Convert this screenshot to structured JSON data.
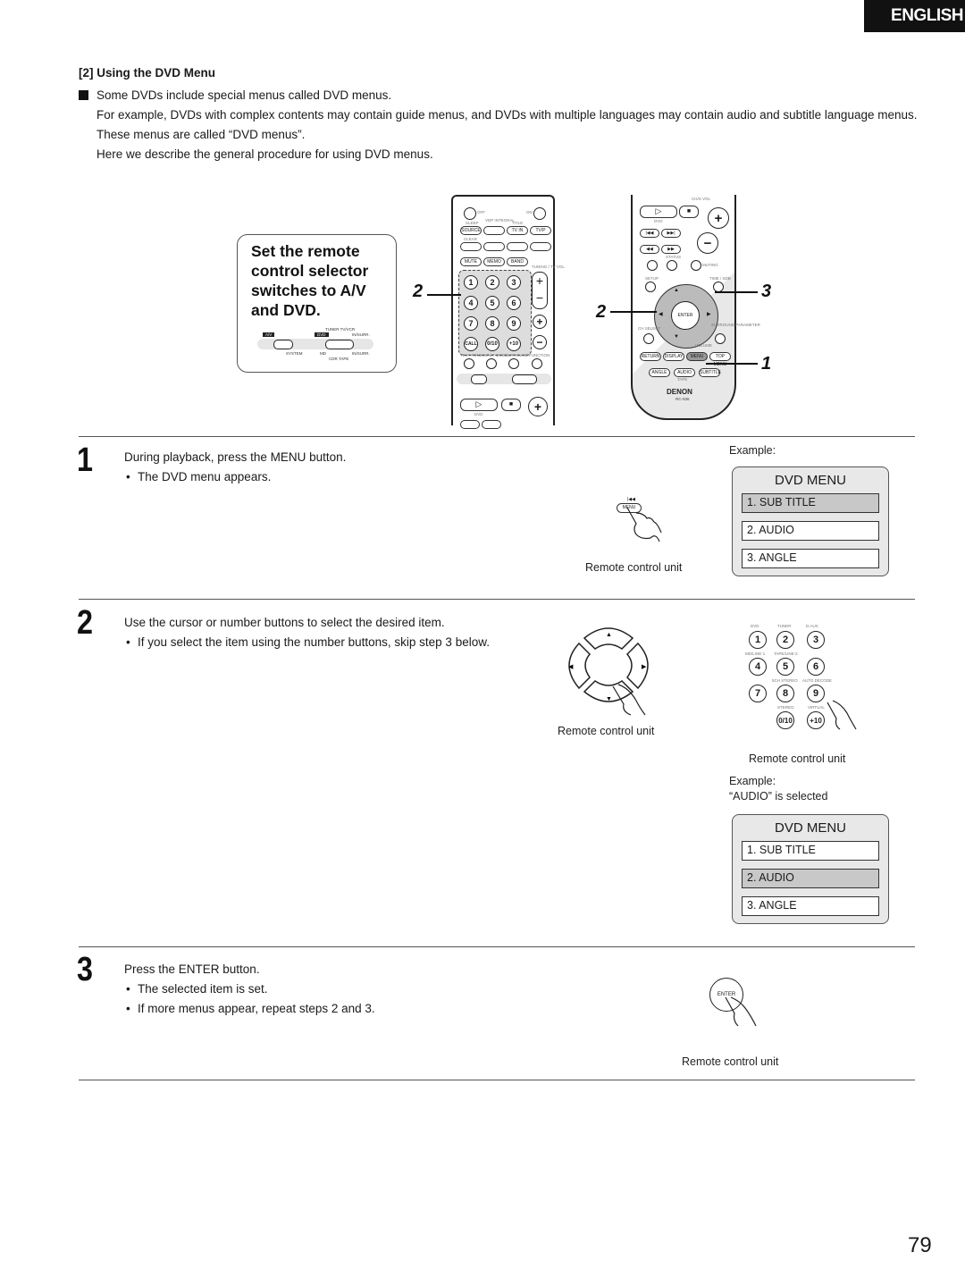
{
  "header": {
    "language_tab": "ENGLISH"
  },
  "section": {
    "title": "[2] Using the DVD Menu",
    "intro": [
      "Some DVDs include special menus called DVD menus.",
      "For example, DVDs with complex contents may contain guide menus, and DVDs with multiple languages may contain audio and subtitle language menus.",
      "These menus are called “DVD menus”.",
      "Here we describe the general procedure for using DVD menus."
    ]
  },
  "callout": {
    "text": "Set the remote control selector switches to A/V and DVD.",
    "switch_labels": {
      "av": "A/V",
      "dvd": "DVD",
      "top_row": "TUNER  TV/VCR",
      "top_end": "IN/SURR.",
      "bottom_left": "SYSTEM",
      "bottom_md": "MD",
      "bottom_row": "CDR  TAPE",
      "bottom_end": "IN/SURR."
    }
  },
  "remote_left": {
    "labels": {
      "off": "OFF",
      "on": "ON",
      "sleep": "SLEEP",
      "source": "SOURCE",
      "vdp": "VDP INTEGRAL",
      "tv_in": "TV IN",
      "title": "TITLE",
      "tv_vcr": "TV/VCR",
      "tvp": "TV/P",
      "clear": "CLEAR",
      "mute": "MUTE",
      "memo": "MEMO",
      "band": "BAND",
      "tuning": "TUNING / TV VOL",
      "test_tone": "TEST TONE",
      "input_mode": "INPUT MODE",
      "surround": "SURROUND",
      "function": "FUNCTION",
      "call": "CALL",
      "dvd": "DVD"
    },
    "number_keys": [
      "1",
      "2",
      "3",
      "4",
      "5",
      "6",
      "7",
      "8",
      "9",
      "0/10",
      "+10"
    ]
  },
  "remote_right": {
    "labels": {
      "ch_vol": "CH/S  VOL",
      "dvd": "DVD",
      "status": "STATUS",
      "muting": "MUTING",
      "setup": "SETUP",
      "time_sdb": "TIME / SDB",
      "enter": "ENTER",
      "ch_select": "CH SELECT",
      "surround_param": "SURROUND PARAMETER",
      "vol": "VOLUME",
      "return": "RETURN",
      "display": "DISPLAY",
      "menu": "MENU",
      "top_menu": "TOP MENU",
      "angle": "ANGLE",
      "audio": "AUDIO",
      "subtitle": "SUBTITLE",
      "tape": "TAPE",
      "brand": "DENON",
      "model": "RC-936"
    }
  },
  "callout_numbers": {
    "left_remote": "2",
    "right_remote_cursor": "2",
    "right_remote_enter": "3",
    "right_remote_menu": "1"
  },
  "steps": [
    {
      "number": "1",
      "text": "During playback, press the MENU button.",
      "bullets": [
        "The DVD menu appears."
      ],
      "illustration_button": "MENU",
      "caption": "Remote control unit",
      "example_label": "Example:",
      "menu": {
        "title": "DVD MENU",
        "items": [
          "1. SUB TITLE",
          "2. AUDIO",
          "3. ANGLE"
        ],
        "selected_index": 0
      }
    },
    {
      "number": "2",
      "text": "Use the cursor or number buttons to select the desired item.",
      "bullets": [
        "If you select the item using the number buttons, skip step 3 below."
      ],
      "caption_cursor": "Remote control unit",
      "caption_numpad": "Remote control unit",
      "numpad_keys": [
        {
          "key": "1",
          "label": "DVD"
        },
        {
          "key": "2",
          "label": "TUNER"
        },
        {
          "key": "3",
          "label": "D.AUX"
        },
        {
          "key": "4",
          "label": "MD/LINE-1"
        },
        {
          "key": "5",
          "label": "TAPE/LINE-2"
        },
        {
          "key": "6",
          "label": ""
        },
        {
          "key": "7",
          "label": ""
        },
        {
          "key": "8",
          "label": "5CH STEREO"
        },
        {
          "key": "9",
          "label": "AUTO DECODE"
        },
        {
          "key": "0/10",
          "label": "STEREO"
        },
        {
          "key": "+10",
          "label": "VIRTUAL"
        }
      ],
      "example_label": "Example:",
      "example_sub": "“AUDIO” is selected",
      "menu": {
        "title": "DVD MENU",
        "items": [
          "1. SUB TITLE",
          "2. AUDIO",
          "3. ANGLE"
        ],
        "selected_index": 1
      }
    },
    {
      "number": "3",
      "text": "Press the ENTER button.",
      "bullets": [
        "The selected item is set.",
        "If more menus appear, repeat steps 2 and 3."
      ],
      "illustration_button": "ENTER",
      "caption": "Remote control unit"
    }
  ],
  "footer": {
    "page_number": "79"
  }
}
